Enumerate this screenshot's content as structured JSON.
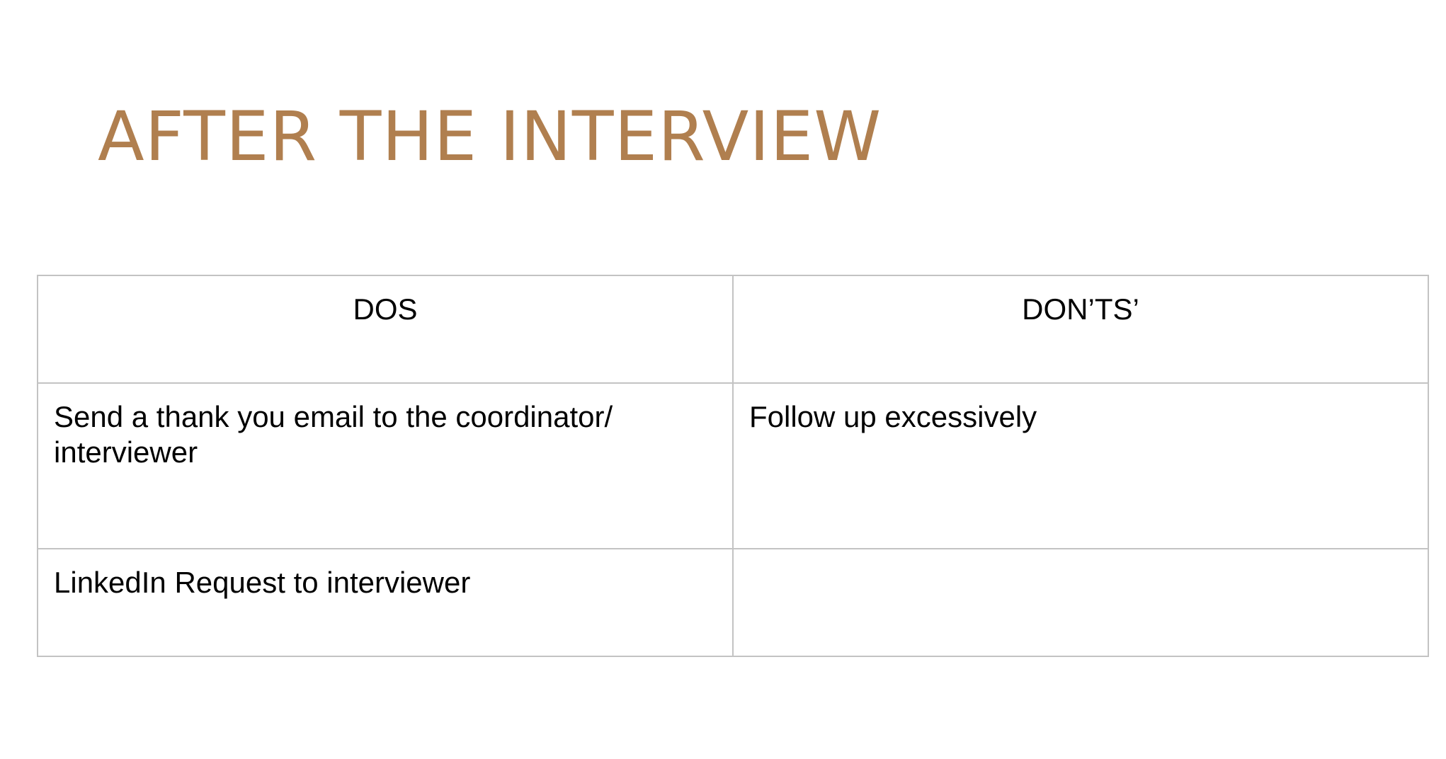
{
  "slide": {
    "title": "AFTER THE INTERVIEW",
    "title_color": "#b07f4f"
  },
  "table": {
    "headers": [
      "DOS",
      "DON’TS’"
    ],
    "rows": [
      [
        "Send a thank you email to the coordinator/ interviewer",
        "Follow up excessively"
      ],
      [
        "LinkedIn Request to interviewer",
        ""
      ]
    ],
    "border_color": "#c3c3c3"
  }
}
